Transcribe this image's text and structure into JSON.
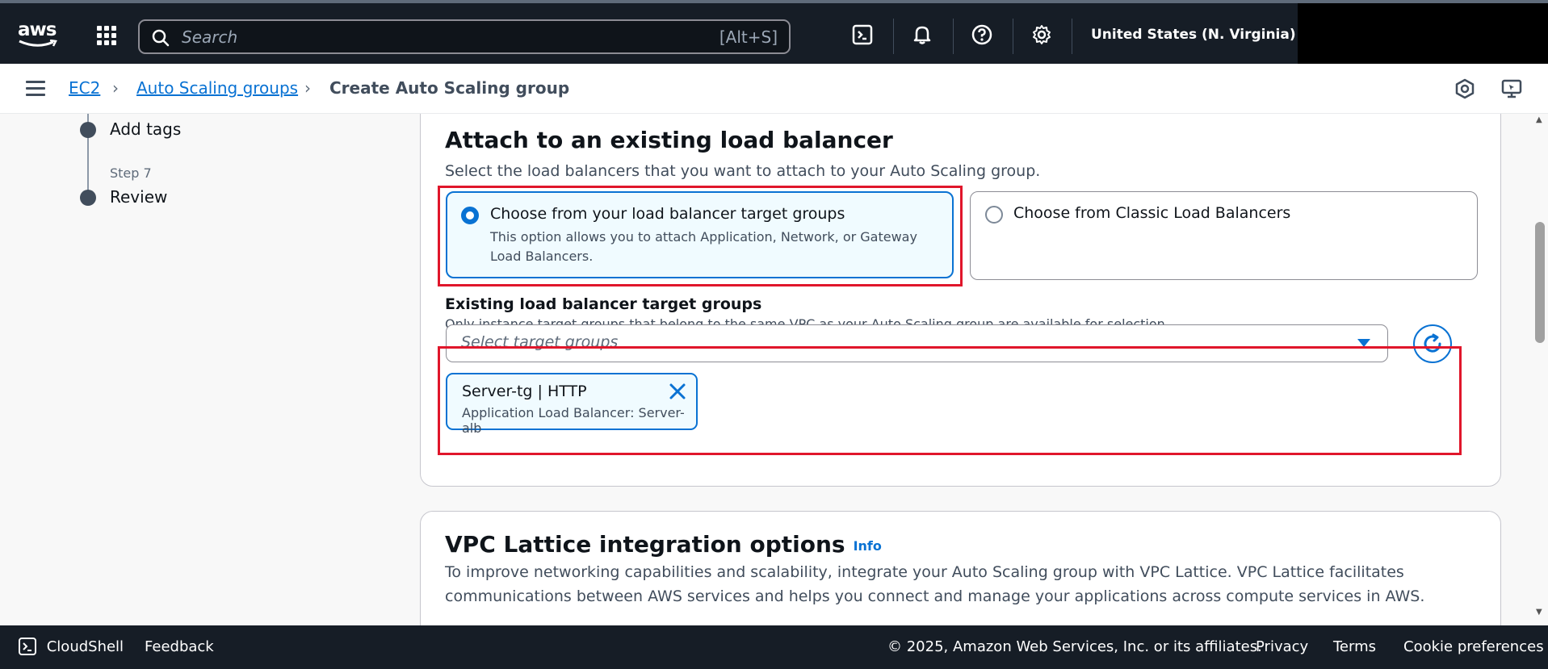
{
  "topnav": {
    "logo": "aws",
    "search_placeholder": "Search",
    "search_shortcut": "[Alt+S]",
    "region": "United States (N. Virginia)",
    "icons": [
      "cloudshell-icon",
      "bell-icon",
      "help-icon",
      "gear-icon"
    ]
  },
  "breadcrumb": {
    "items": [
      "EC2",
      "Auto Scaling groups",
      "Create Auto Scaling group"
    ]
  },
  "steps": {
    "items": [
      {
        "number": "",
        "title": "Add tags"
      },
      {
        "number": "Step 7",
        "title": "Review"
      }
    ]
  },
  "load_balancer": {
    "title": "Attach to an existing load balancer",
    "description": "Select the load balancers that you want to attach to your Auto Scaling group.",
    "options": [
      {
        "label": "Choose from your load balancer target groups",
        "description_line1": "This option allows you to attach Application, Network, or Gateway",
        "description_line2": "Load Balancers.",
        "selected": true
      },
      {
        "label": "Choose from Classic Load Balancers",
        "selected": false
      }
    ],
    "target_groups_label": "Existing load balancer target groups",
    "target_groups_hint": "Only instance target groups that belong to the same VPC as your Auto Scaling group are available for selection.",
    "select_placeholder": "Select target groups",
    "token": {
      "title": "Server-tg | HTTP",
      "subtitle": "Application Load Balancer: Server-alb"
    }
  },
  "vpc_lattice": {
    "title": "VPC Lattice integration options",
    "info": "Info",
    "description_line1": "To improve networking capabilities and scalability, integrate your Auto Scaling group with VPC Lattice. VPC Lattice facilitates",
    "description_line2": "communications between AWS services and helps you connect and manage your applications across compute services in AWS."
  },
  "footer": {
    "cloudshell": "CloudShell",
    "feedback": "Feedback",
    "copyright": "© 2025, Amazon Web Services, Inc. or its affiliates.",
    "privacy": "Privacy",
    "terms": "Terms",
    "cookie": "Cookie preferences"
  },
  "colors": {
    "nav_bg": "#161d26",
    "accent": "#0972d3",
    "highlight": "#e0162b"
  }
}
